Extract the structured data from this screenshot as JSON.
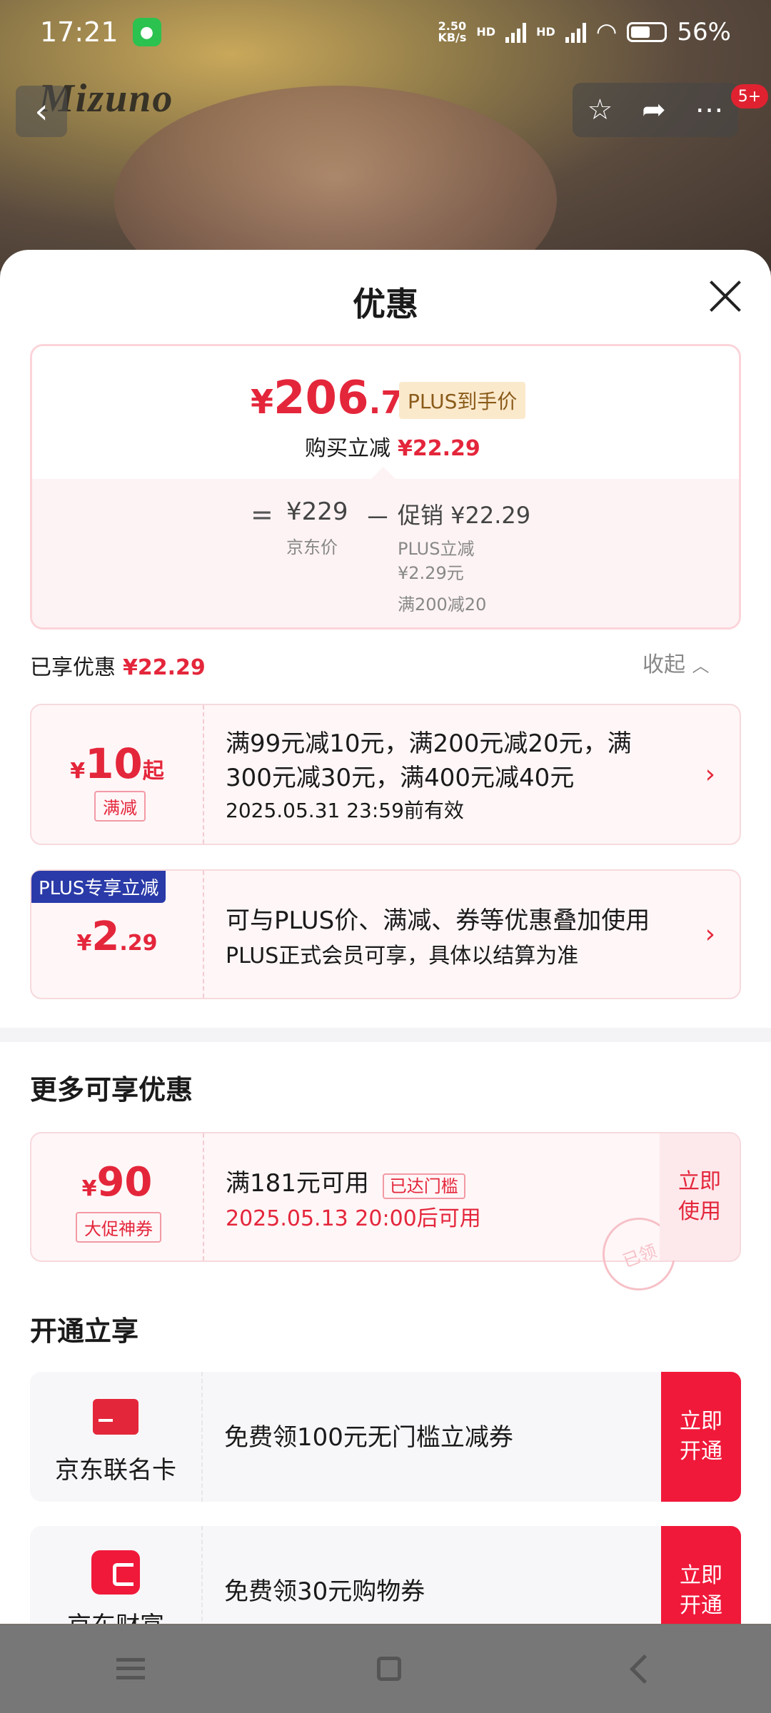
{
  "status_bar": {
    "time": "17:21",
    "net_speed_top": "2.50",
    "net_speed_bottom": "KB/s",
    "hd1": "HD",
    "hd2": "HD",
    "battery": "56%"
  },
  "background": {
    "logo": "Mizuno"
  },
  "top_controls": {
    "badge": "5+"
  },
  "sheet": {
    "title": "优惠",
    "price_card": {
      "currency": "¥",
      "price_int": "206",
      "price_dec": ".71",
      "plus_tag": "PLUS到手价",
      "buy_reduce_label": "购买立减",
      "buy_reduce_value": "¥22.29",
      "equals": "=",
      "jd_price": "¥229",
      "jd_price_label": "京东价",
      "minus": "－",
      "promo": "促销 ¥22.29",
      "promo_sub1": "PLUS立减",
      "promo_sub2": "¥2.29元",
      "promo_sub3": "满200减20"
    },
    "enjoyed": {
      "label": "已享优惠",
      "value": "¥22.29",
      "collapse": "收起"
    },
    "coupons": [
      {
        "amount_sym": "¥",
        "amount": "10",
        "amount_suffix": "起",
        "tag": "满减",
        "line1": "满99元减10元，满200元减20元，满",
        "line2": "300元减30元，满400元减40元",
        "line3": "2025.05.31 23:59前有效"
      },
      {
        "ribbon": "PLUS专享立减",
        "amount_sym": "¥",
        "amount": "2",
        "amount_dec": ".29",
        "line1": "可与PLUS价、满减、券等优惠叠加使用",
        "line2": "PLUS正式会员可享，具体以结算为准"
      }
    ],
    "more_title": "更多可享优惠",
    "promo_coupon": {
      "amount_sym": "¥",
      "amount": "90",
      "tag": "大促神券",
      "line1": "满181元可用",
      "threshold_tag": "已达门槛",
      "line2": "2025.05.13 20:00后可用",
      "stamp": "已领",
      "button": "立即\n使用"
    },
    "open_title": "开通立享",
    "services": [
      {
        "name": "京东联名卡",
        "desc": "免费领100元无门槛立减券",
        "button": "立即\n开通"
      },
      {
        "name": "京东财富",
        "desc": "免费领30元购物券",
        "button": "立即\n开通"
      }
    ]
  }
}
